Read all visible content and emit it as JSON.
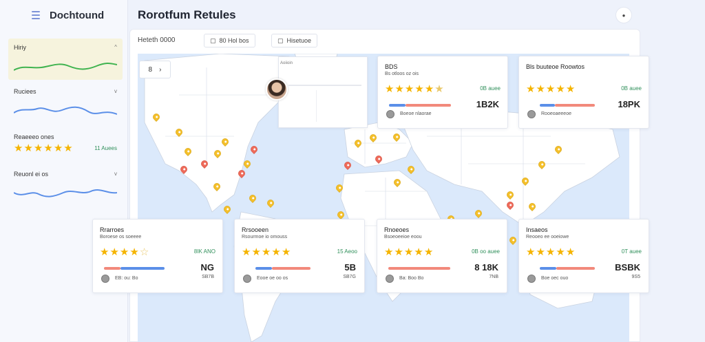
{
  "app": {
    "title": "Dochtound",
    "page_title": "Rorotfum Retules",
    "header_btn": "●"
  },
  "sidebar": {
    "widgets": [
      {
        "label": "Hiriy",
        "chevron": "^",
        "color": "#3fb34f"
      },
      {
        "label": "Ruciees",
        "chevron": "v",
        "color": "#5b8fe8"
      },
      {
        "label": "Reaeeeo ones",
        "stars": 6,
        "green": "11 Auees"
      },
      {
        "label": "Reuonl ei os",
        "chevron": "v",
        "color": "#5b8fe8"
      }
    ]
  },
  "toolbar": {
    "label": "Heteth 0000",
    "btn1": "80 Hol bos",
    "btn1_icon": "▢",
    "btn2": "Hisetuoe",
    "btn2_icon": "▢"
  },
  "map": {
    "zoom_label": "8",
    "zoom_sep": "›",
    "close": "x"
  },
  "popup": {
    "label": "Aoiioin"
  },
  "cards": [
    {
      "title": "BDS",
      "sub": "Bs otloos oz ois",
      "green": "0B auee",
      "big": "1B2K",
      "foot": "Boeoe nlaorae",
      "foot_r": ""
    },
    {
      "title": "Bls buuteoe Roowtos",
      "sub": "",
      "green": "0B auee",
      "big": "18PK",
      "foot": "Rooeoaeeeoe",
      "foot_r": ""
    },
    {
      "title": "Rrarroes",
      "sub": "Boroese os soeeee",
      "green": "8IK ANO",
      "big": "NG",
      "foot": "EB: ou: Bo",
      "foot_r": "SB7B"
    },
    {
      "title": "Rrsooeen",
      "sub": "Rsourmoe io omouss",
      "green": "15 Aeoo",
      "big": "5B",
      "foot": "Eooe oe oo os",
      "foot_r": "SB7G"
    },
    {
      "title": "Rnoeoes",
      "sub": "Bsoeoeeioe eoou",
      "green": "0B oo auee",
      "big": "8 18K",
      "foot": "Ba: Boo Bo",
      "foot_r": "7NB"
    },
    {
      "title": "Insaeos",
      "sub": "Reooeo ee ooeiowe",
      "green": "0T auee",
      "big": "BSBK",
      "foot": "Boe oec ouo",
      "foot_r": "9S5"
    }
  ]
}
